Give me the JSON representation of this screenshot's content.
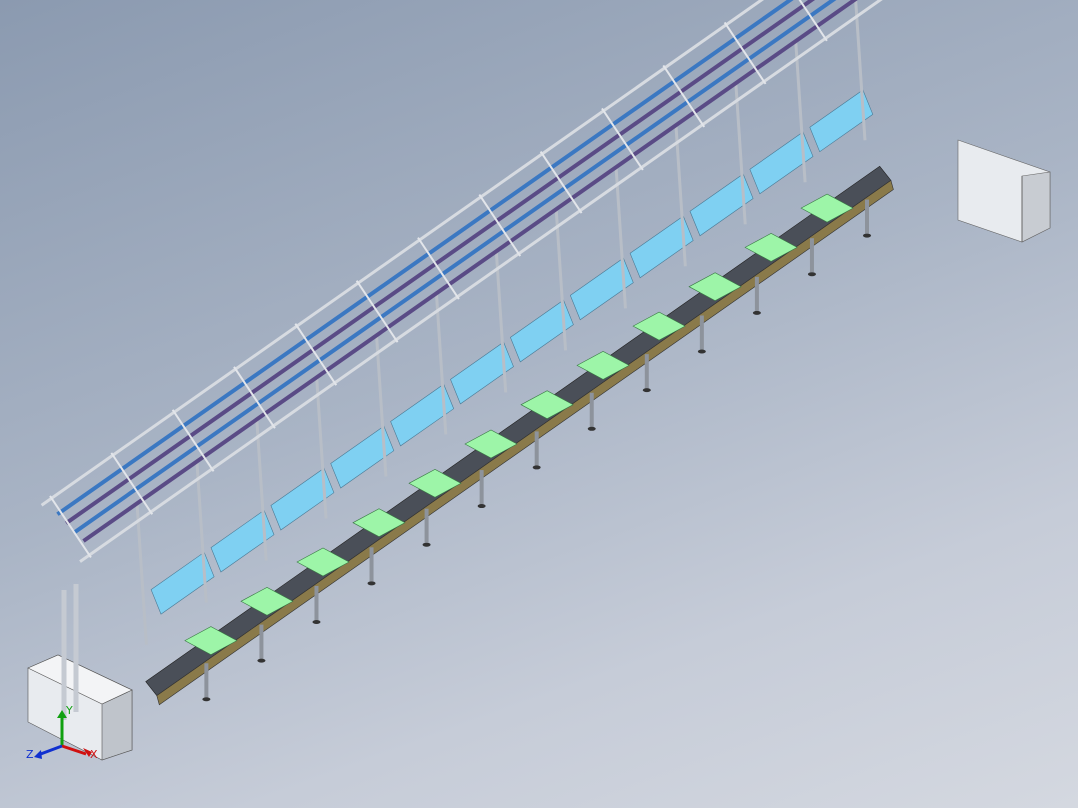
{
  "model": {
    "workstations": 12,
    "overhead_light_rails": 4,
    "colors": {
      "background_top": "#8b9ab0",
      "background_bottom": "#d4d8e0",
      "frame": "#c9ced6",
      "frame_dark": "#7a808a",
      "shelf_blue": "#7fd0f2",
      "work_pad_green": "#9df5a8",
      "light_tube_purple": "#5a4b86",
      "conveyor_dark": "#4a4f58",
      "cabinet": "#e8ebef"
    }
  },
  "triad": {
    "x_label": "X",
    "y_label": "Y",
    "z_label": "Z",
    "x_color": "#d01010",
    "y_color": "#10a010",
    "z_color": "#1030d0"
  }
}
